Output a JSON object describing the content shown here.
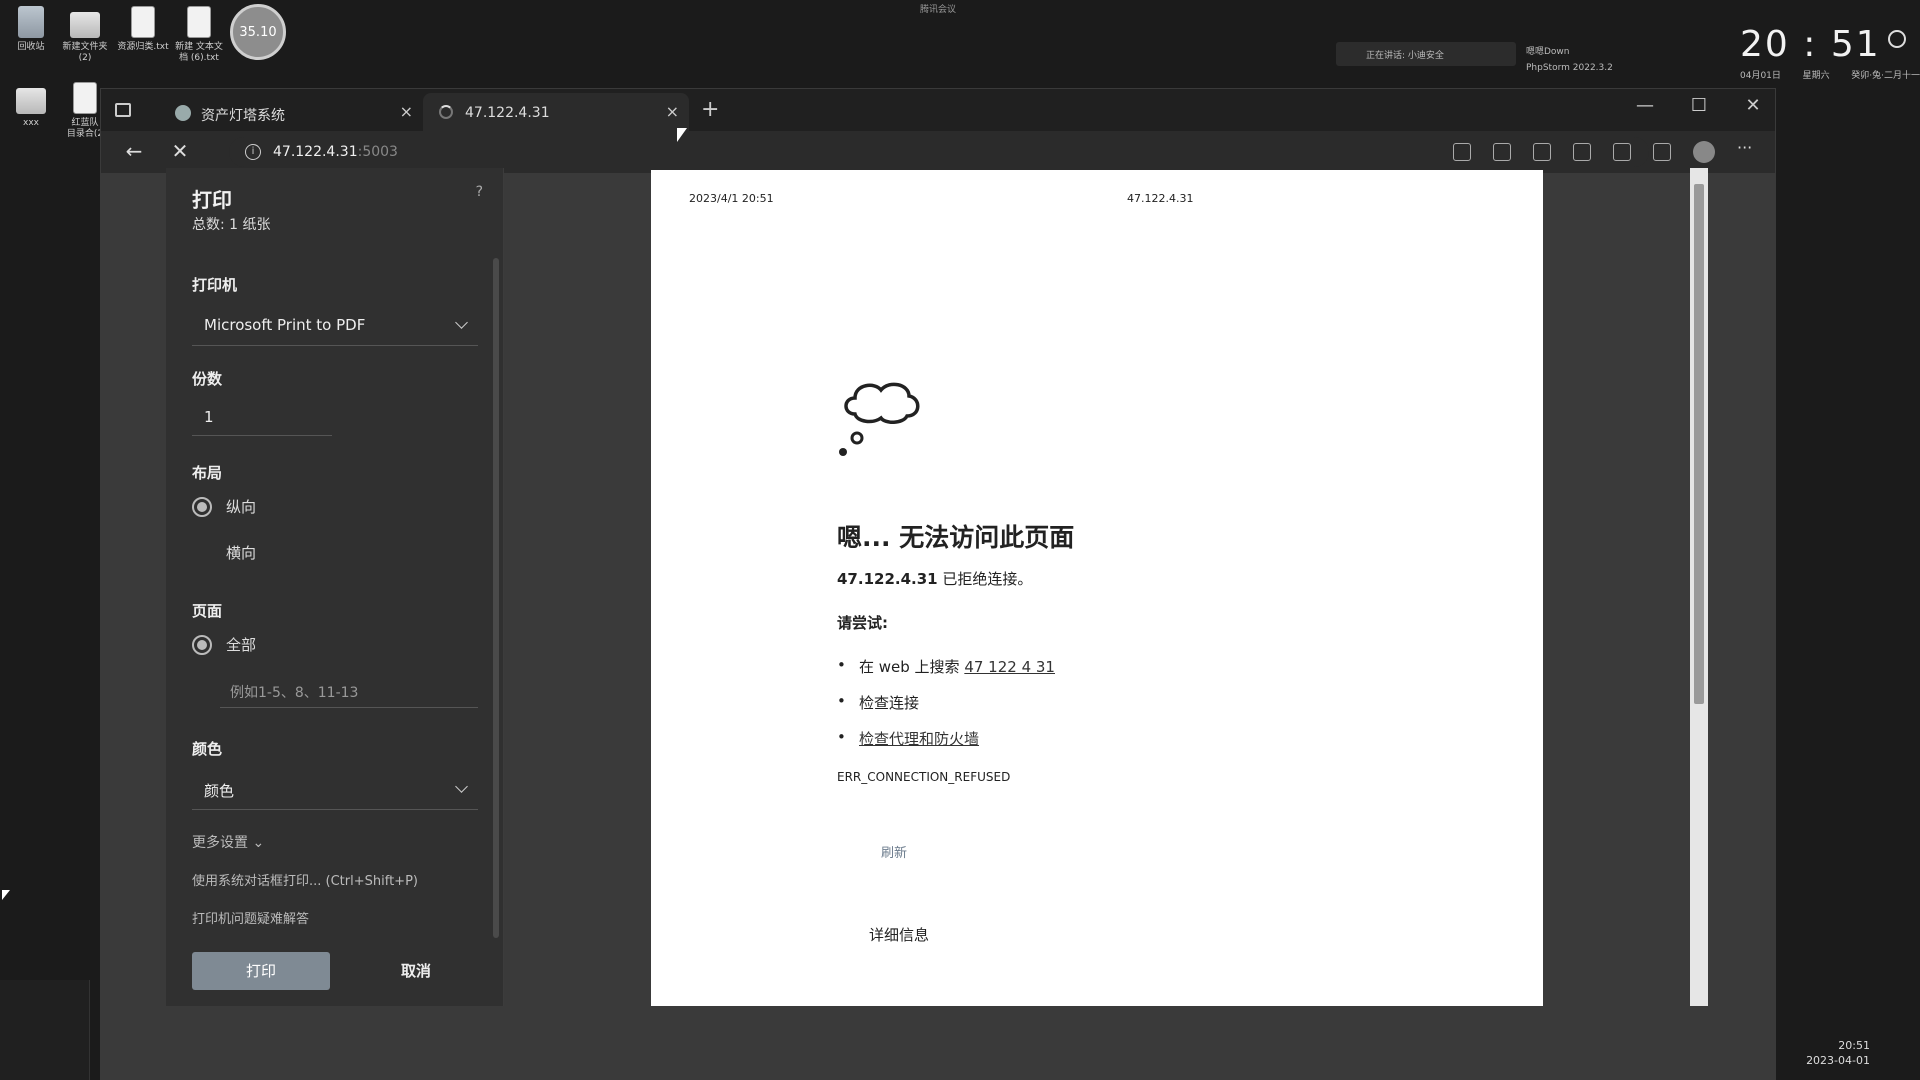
{
  "desktop": {
    "icons": [
      "回收站",
      "新建文件夹\n(2)",
      "资源归类.txt",
      "新建 文本文\n档 (6).txt"
    ],
    "icons_row2": [
      "xxx",
      "红蓝队\n目录合(2"
    ],
    "circle_badge": "35.10",
    "top_center_text": "腾讯会议",
    "clock": "20 : 51",
    "clock_sub": [
      "04月01日",
      "星期六",
      "癸卯·兔·二月十一"
    ],
    "notification": "正在讲话: 小迪安全",
    "recent_items": [
      "嗯嗯Down",
      "PhpStorm 2022.3.2"
    ],
    "taskbar_time": "20:51",
    "taskbar_date": "2023-04-01"
  },
  "browser": {
    "tabs": [
      {
        "label": "资产灯塔系统",
        "close": "×"
      },
      {
        "label": "47.122.4.31",
        "close": "×"
      }
    ],
    "new_tab": "+",
    "window_controls": [
      "—",
      "☐",
      "✕"
    ],
    "nav": {
      "back": "←",
      "stop": "✕"
    },
    "address": {
      "host": "47.122.4.31",
      "port": ":5003",
      "info": "i"
    },
    "more": "···"
  },
  "print_dialog": {
    "title": "打印",
    "help": "?",
    "total": "总数: 1 纸张",
    "printer_label": "打印机",
    "printer_value": "Microsoft Print to PDF",
    "copies_label": "份数",
    "copies_value": "1",
    "layout_label": "布局",
    "layout_portrait": "纵向",
    "layout_landscape": "横向",
    "pages_label": "页面",
    "pages_all": "全部",
    "pages_placeholder": "例如1-5、8、11-13",
    "color_label": "颜色",
    "color_value": "颜色",
    "more_settings": "更多设置 ⌄",
    "system_dialog": "使用系统对话框打印... (Ctrl+Shift+P)",
    "troubleshoot": "打印机问题疑难解答",
    "print_button": "打印",
    "cancel_button": "取消"
  },
  "preview": {
    "date": "2023/4/1 20:51",
    "host": "47.122.4.31",
    "heading": "嗯... 无法访问此页面",
    "refused_host": "47.122.4.31",
    "refused_text": " 已拒绝连接。",
    "try_label": "请尝试:",
    "bullet1_prefix": "在 web 上搜索 ",
    "bullet1_link": "47 122 4 31",
    "bullet2": "检查连接",
    "bullet3": "检查代理和防火墙",
    "error_code": "ERR_CONNECTION_REFUSED",
    "refresh": "刷新",
    "details": "详细信息"
  }
}
